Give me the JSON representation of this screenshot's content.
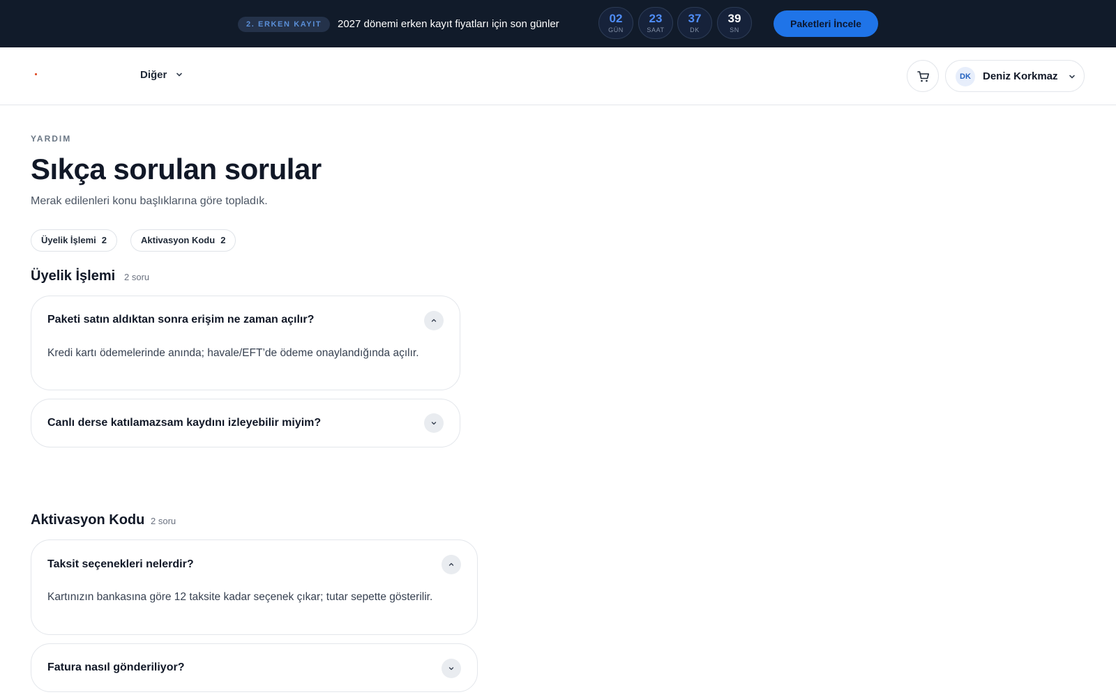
{
  "promo": {
    "badge": "2. ERKEN KAYIT",
    "text": "2027 dönemi erken kayıt fiyatları için son günler",
    "countdown": [
      {
        "value": "02",
        "label": "GÜN"
      },
      {
        "value": "23",
        "label": "SAAT"
      },
      {
        "value": "37",
        "label": "DK"
      },
      {
        "value": "39",
        "label": "SN"
      }
    ],
    "cta": "Paketleri İncele"
  },
  "header": {
    "nav_more": "Diğer",
    "user": {
      "initials": "DK",
      "name": "Deniz Korkmaz"
    }
  },
  "page": {
    "eyebrow": "YARDIM",
    "title": "Sıkça sorulan sorular",
    "subtitle": "Merak edilenleri konu başlıklarına göre topladık."
  },
  "chips": [
    {
      "label": "Üyelik İşlemi",
      "count": "2"
    },
    {
      "label": "Aktivasyon Kodu",
      "count": "2"
    }
  ],
  "sections": [
    {
      "title": "Üyelik İşlemi",
      "count": "2 soru",
      "items": [
        {
          "question": "Paketi satın aldıktan sonra erişim ne zaman açılır?",
          "answer": "Kredi kartı ödemelerinde anında; havale/EFT’de ödeme onaylandığında açılır.",
          "expanded": true
        },
        {
          "question": "Canlı derse katılamazsam kaydını izleyebilir miyim?",
          "answer": "",
          "expanded": false
        }
      ]
    },
    {
      "title": "Aktivasyon Kodu",
      "count": "2 soru",
      "items": [
        {
          "question": "Taksit seçenekleri nelerdir?",
          "answer": "Kartınızın bankasına göre 12 taksite kadar seçenek çıkar; tutar sepette gösterilir.",
          "expanded": true
        },
        {
          "question": "Fatura nasıl gönderiliyor?",
          "answer": "",
          "expanded": false
        }
      ]
    }
  ],
  "colors": {
    "promo_bg": "#111b2a",
    "accent": "#1f74e8",
    "countdown_num": "#4f8df7",
    "logo_dot": "#e0502a"
  },
  "icons": {
    "cart": "shopping-cart-icon",
    "chevron_down": "chevron-down-icon",
    "chevron_up": "chevron-up-icon"
  }
}
